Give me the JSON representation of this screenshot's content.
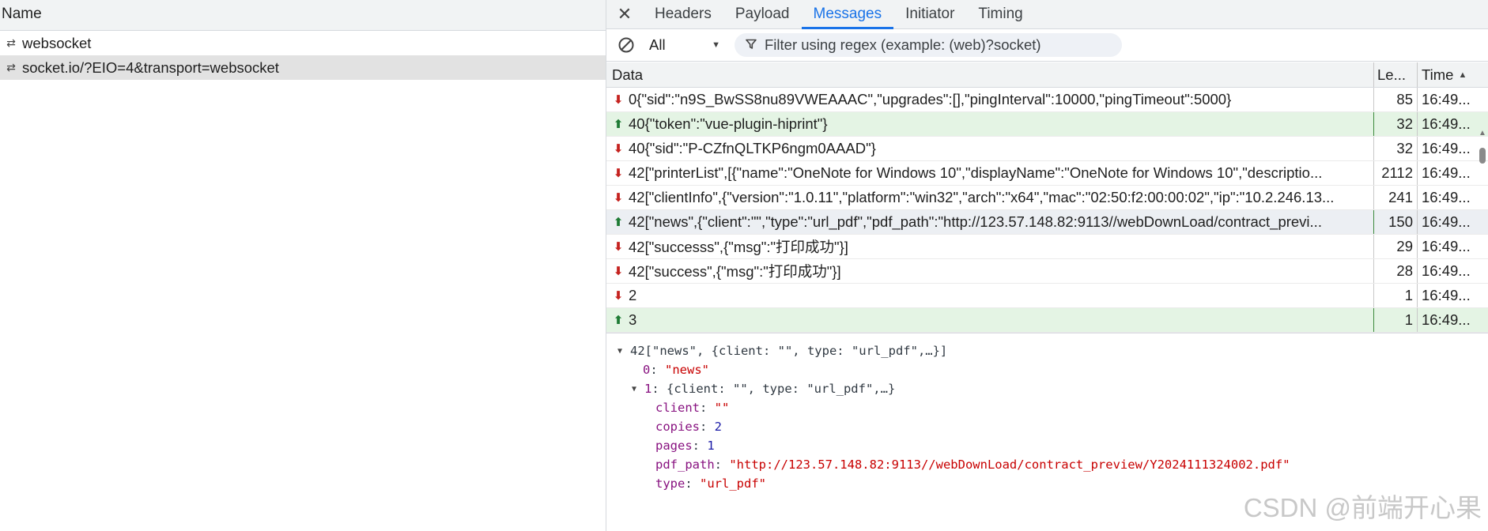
{
  "left_pane": {
    "header": "Name",
    "rows": [
      {
        "label": "websocket"
      },
      {
        "label": "socket.io/?EIO=4&transport=websocket"
      }
    ]
  },
  "tabs": {
    "items": [
      "Headers",
      "Payload",
      "Messages",
      "Initiator",
      "Timing"
    ],
    "active": "Messages"
  },
  "filter": {
    "type_value": "All",
    "search_placeholder": "Filter using regex (example: (web)?socket)"
  },
  "table": {
    "columns": {
      "data": "Data",
      "length": "Le...",
      "time": "Time"
    },
    "rows": [
      {
        "direction": "received",
        "data": "0{\"sid\":\"n9S_BwSS8nu89VWEAAAC\",\"upgrades\":[],\"pingInterval\":10000,\"pingTimeout\":5000}",
        "length": "85",
        "time": "16:49..."
      },
      {
        "direction": "sent",
        "data": "40{\"token\":\"vue-plugin-hiprint\"}",
        "length": "32",
        "time": "16:49..."
      },
      {
        "direction": "received",
        "data": "40{\"sid\":\"P-CZfnQLTKP6ngm0AAAD\"}",
        "length": "32",
        "time": "16:49..."
      },
      {
        "direction": "received",
        "data": "42[\"printerList\",[{\"name\":\"OneNote for Windows 10\",\"displayName\":\"OneNote for Windows 10\",\"descriptio...",
        "length": "2112",
        "time": "16:49..."
      },
      {
        "direction": "received",
        "data": "42[\"clientInfo\",{\"version\":\"1.0.11\",\"platform\":\"win32\",\"arch\":\"x64\",\"mac\":\"02:50:f2:00:00:02\",\"ip\":\"10.2.246.13...",
        "length": "241",
        "time": "16:49..."
      },
      {
        "direction": "sent",
        "data": "42[\"news\",{\"client\":\"\",\"type\":\"url_pdf\",\"pdf_path\":\"http://123.57.148.82:9113//webDownLoad/contract_previ...",
        "length": "150",
        "time": "16:49..."
      },
      {
        "direction": "received",
        "data": "42[\"successs\",{\"msg\":\"打印成功\"}]",
        "length": "29",
        "time": "16:49..."
      },
      {
        "direction": "received",
        "data": "42[\"success\",{\"msg\":\"打印成功\"}]",
        "length": "28",
        "time": "16:49..."
      },
      {
        "direction": "received",
        "data": "2",
        "length": "1",
        "time": "16:49..."
      },
      {
        "direction": "sent",
        "data": "3",
        "length": "1",
        "time": "16:49..."
      }
    ]
  },
  "detail": {
    "root": "42[\"news\", {client: \"\", type: \"url_pdf\",…}]",
    "item0_key": "0",
    "item0_val": "\"news\"",
    "item1_key": "1",
    "item1_summary": "{client: \"\", type: \"url_pdf\",…}",
    "fields": [
      {
        "key": "client",
        "value": "\"\"",
        "kind": "string"
      },
      {
        "key": "copies",
        "value": "2",
        "kind": "number"
      },
      {
        "key": "pages",
        "value": "1",
        "kind": "number"
      },
      {
        "key": "pdf_path",
        "value": "\"http://123.57.148.82:9113//webDownLoad/contract_preview/Y2024111324002.pdf\"",
        "kind": "string"
      },
      {
        "key": "type",
        "value": "\"url_pdf\"",
        "kind": "string"
      }
    ]
  },
  "watermark": "CSDN @前端开心果"
}
